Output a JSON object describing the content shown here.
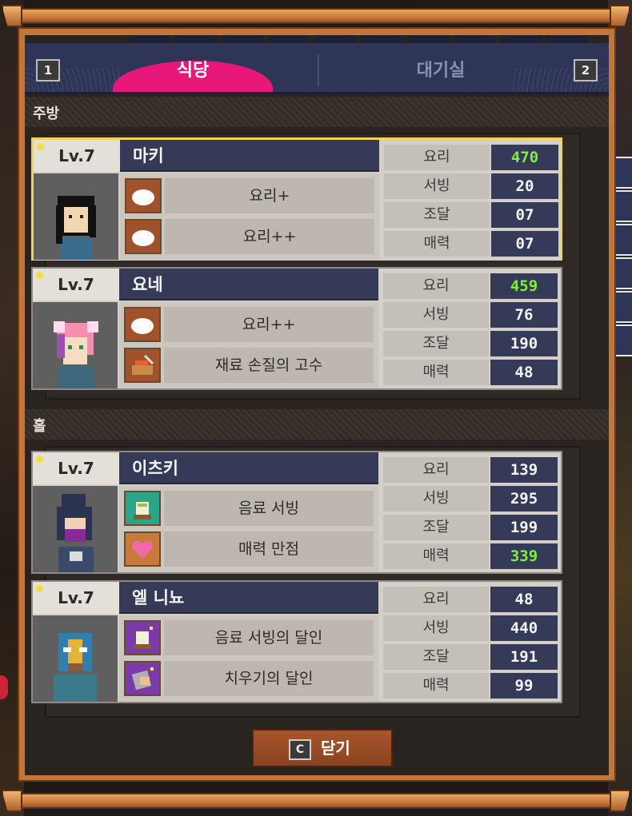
{
  "tabs": [
    {
      "key": "1",
      "label": "식당",
      "active": true
    },
    {
      "key": "2",
      "label": "대기실",
      "active": false
    }
  ],
  "sections": [
    {
      "title": "주방",
      "staff": [
        {
          "level": "Lv.7",
          "name": "마키",
          "selected": true,
          "skills": [
            {
              "icon": "dumpling-icon",
              "label": "요리+"
            },
            {
              "icon": "dumpling-icon",
              "label": "요리++"
            }
          ],
          "stats": [
            {
              "label": "요리",
              "value": "470",
              "highlight": true
            },
            {
              "label": "서빙",
              "value": "20"
            },
            {
              "label": "조달",
              "value": "07"
            },
            {
              "label": "매력",
              "value": "07"
            }
          ]
        },
        {
          "level": "Lv.7",
          "name": "요네",
          "selected": false,
          "skills": [
            {
              "icon": "dumpling-icon",
              "label": "요리++"
            },
            {
              "icon": "knife-board-icon",
              "label": "재료 손질의 고수"
            }
          ],
          "stats": [
            {
              "label": "요리",
              "value": "459",
              "highlight": true
            },
            {
              "label": "서빙",
              "value": "76"
            },
            {
              "label": "조달",
              "value": "190"
            },
            {
              "label": "매력",
              "value": "48"
            }
          ]
        }
      ]
    },
    {
      "title": "홀",
      "staff": [
        {
          "level": "Lv.7",
          "name": "이츠키",
          "selected": false,
          "skills": [
            {
              "icon": "tea-cup-icon",
              "label": "음료 서빙"
            },
            {
              "icon": "heart-icon",
              "label": "매력 만점"
            }
          ],
          "stats": [
            {
              "label": "요리",
              "value": "139"
            },
            {
              "label": "서빙",
              "value": "295"
            },
            {
              "label": "조달",
              "value": "199"
            },
            {
              "label": "매력",
              "value": "339",
              "highlight": true
            }
          ]
        },
        {
          "level": "Lv.7",
          "name": "엘 니뇨",
          "selected": false,
          "skills": [
            {
              "icon": "tea-cup-sparkle-icon",
              "label": "음료 서빙의 달인"
            },
            {
              "icon": "cleaning-cloth-icon",
              "label": "치우기의 달인"
            }
          ],
          "stats": [
            {
              "label": "요리",
              "value": "48"
            },
            {
              "label": "서빙",
              "value": "440"
            },
            {
              "label": "조달",
              "value": "191"
            },
            {
              "label": "매력",
              "value": "99"
            }
          ]
        }
      ]
    }
  ],
  "close_button": {
    "key": "C",
    "label": "닫기"
  },
  "colors": {
    "active_tab": "#e8187a",
    "highlight_stat": "#7df03a",
    "selected_border": "#f0d45a"
  }
}
